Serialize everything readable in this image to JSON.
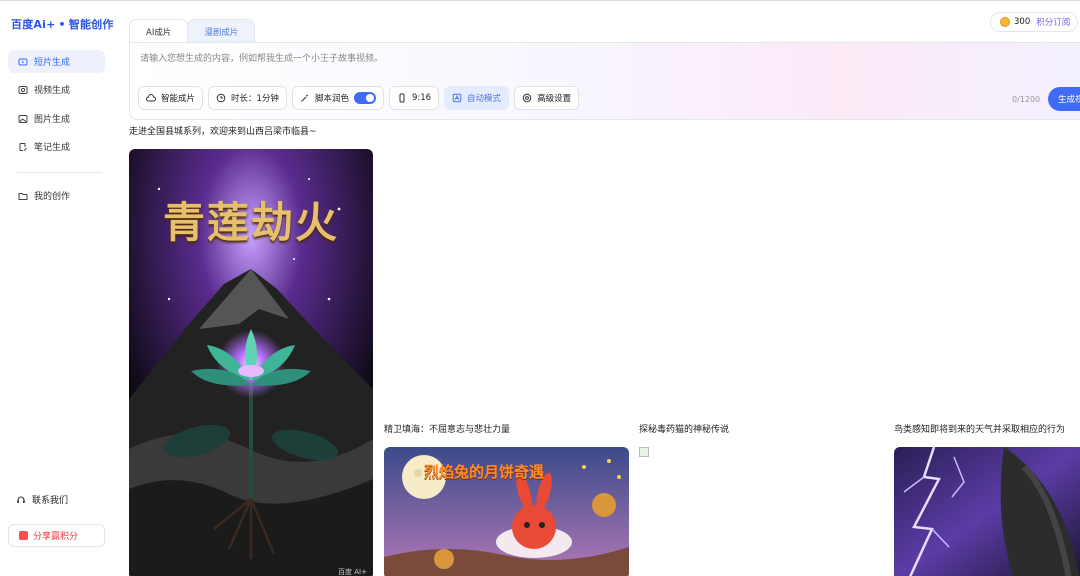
{
  "brand": {
    "logo": "百度Ai+",
    "suffix": "智能创作"
  },
  "sidebar": {
    "items": [
      {
        "label": "短片生成",
        "icon": "film-icon",
        "active": true
      },
      {
        "label": "视频生成",
        "icon": "video-icon",
        "active": false
      },
      {
        "label": "图片生成",
        "icon": "image-icon",
        "active": false
      },
      {
        "label": "笔记生成",
        "icon": "note-icon",
        "active": false
      },
      {
        "label": "我的创作",
        "icon": "folder-icon",
        "active": false
      }
    ],
    "contact": "联系我们",
    "share": "分享赢积分"
  },
  "credits": {
    "amount": "300",
    "subscribe": "积分订阅"
  },
  "tabs": [
    {
      "label": "AI成片"
    },
    {
      "label": "漫剧成片"
    }
  ],
  "composer": {
    "placeholder": "请输入您想生成的内容，例如帮我生成一个小王子故事视频。",
    "smart": "智能成片",
    "duration": "时长：1分钟",
    "polish": "脚本润色",
    "ratio": "9:16",
    "auto": "自动模式",
    "advanced": "高级设置",
    "counter": "0/1200",
    "generate": "生成视频"
  },
  "feed": {
    "intro": "走进全国县城系列，欢迎来到山西吕梁市临县~",
    "items": [
      {
        "title": "精卫填海：不屈意志与悲壮力量",
        "poster": "烈焰兔的月饼奇遇"
      },
      {
        "title": "探秘毒药猫的神秘传说"
      },
      {
        "title": "鸟类感知即将到来的天气并采取相应的行为"
      }
    ],
    "first_poster": "青莲劫火",
    "watermark": "百度 AI+"
  },
  "colors": {
    "accent": "#3f6bf5",
    "brand": "#2b55e8",
    "share": "#e8383d"
  }
}
